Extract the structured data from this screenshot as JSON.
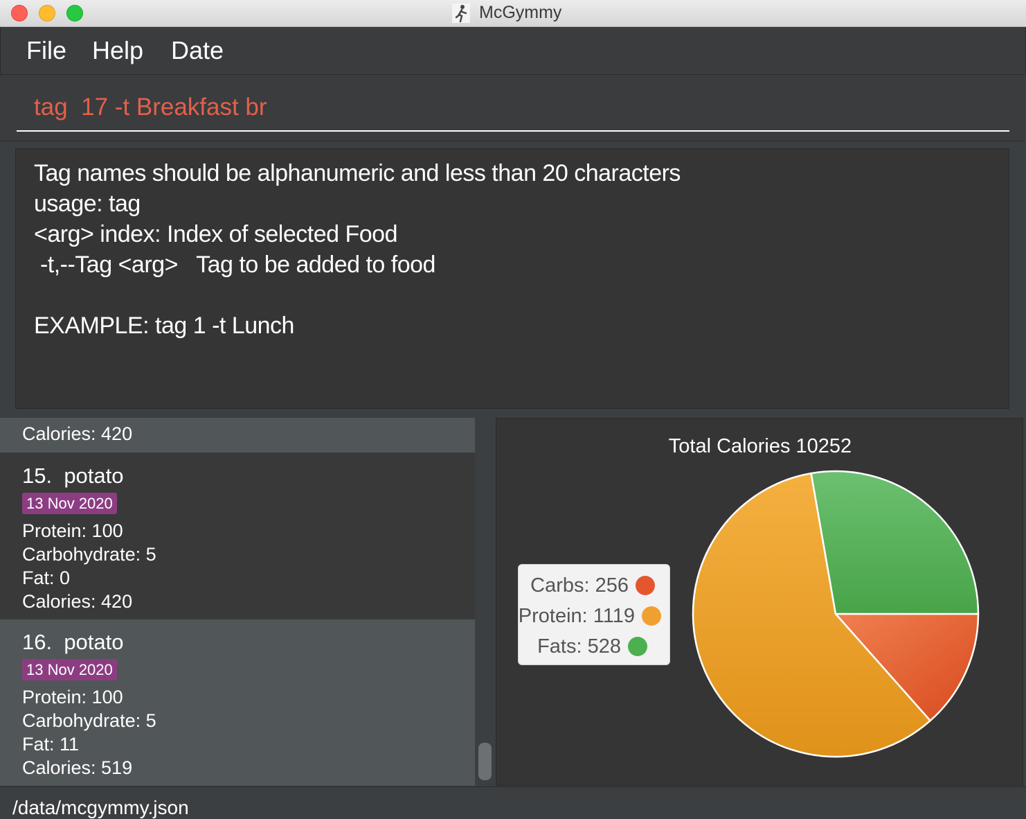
{
  "window": {
    "title": "McGymmy"
  },
  "menu": {
    "items": [
      "File",
      "Help",
      "Date"
    ]
  },
  "command": {
    "text": "tag  17 -t Breakfast br"
  },
  "result": {
    "lines": [
      "Tag names should be alphanumeric and less than 20 characters",
      "usage: tag",
      "<arg> index: Index of selected Food",
      " -t,--Tag <arg>   Tag to be added to food",
      "",
      "EXAMPLE: tag 1 -t Lunch"
    ]
  },
  "food_list": {
    "partial_item": {
      "calories": "Calories: 420"
    },
    "items": [
      {
        "title": "15.  potato",
        "date": "13 Nov 2020",
        "protein": "Protein: 100",
        "carbohydrate": "Carbohydrate: 5",
        "fat": "Fat: 0",
        "calories": "Calories: 420"
      },
      {
        "title": "16.  potato",
        "date": "13 Nov 2020",
        "protein": "Protein: 100",
        "carbohydrate": "Carbohydrate: 5",
        "fat": "Fat: 11",
        "calories": "Calories: 519"
      }
    ]
  },
  "chart_data": {
    "type": "pie",
    "title": "Total Calories 10252",
    "slices": [
      {
        "label": "Carbs",
        "value": 256,
        "color": "#e4572e"
      },
      {
        "label": "Protein",
        "value": 1119,
        "color": "#f0a030"
      },
      {
        "label": "Fats",
        "value": 528,
        "color": "#4caf50"
      }
    ],
    "legend": {
      "position": "left",
      "entries": [
        "Carbs: 256",
        "Protein: 1119",
        "Fats: 528"
      ]
    }
  },
  "status": {
    "path": "/data/mcgymmy.json"
  },
  "colors": {
    "command_text": "#e4604a",
    "date_tag": "#8c3d82",
    "carbs": "#e4572e",
    "protein": "#f0a030",
    "fats": "#4caf50"
  }
}
